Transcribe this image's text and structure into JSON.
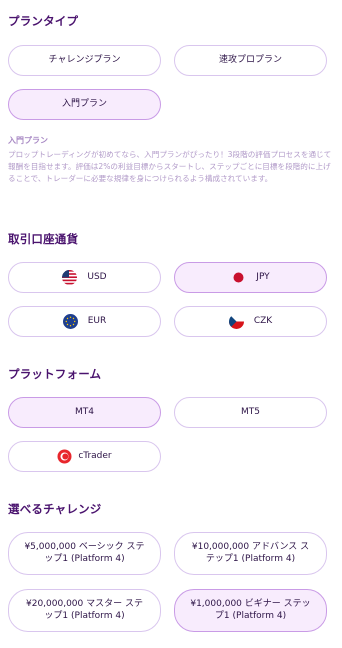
{
  "plan_type": {
    "title": "プランタイプ",
    "options": [
      "チャレンジプラン",
      "速攻プロプラン",
      "入門プラン"
    ],
    "selected": "入門プラン",
    "description_title": "入門プラン",
    "description": "プロップトレーディングが初めてなら、入門プランがぴったり！3段階の評価プロセスを通じて報酬を目指せます。評価は2%の利益目標からスタートし、ステップごとに目標を段階的に上げることで、トレーダーに必要な規律を身につけられるよう構成されています。"
  },
  "currency": {
    "title": "取引口座通貨",
    "options": [
      {
        "label": "USD",
        "icon": "us-flag-icon"
      },
      {
        "label": "JPY",
        "icon": "japan-flag-icon"
      },
      {
        "label": "EUR",
        "icon": "eu-flag-icon"
      },
      {
        "label": "CZK",
        "icon": "czech-flag-icon"
      }
    ],
    "selected": "JPY"
  },
  "platform": {
    "title": "プラットフォーム",
    "options": [
      {
        "label": "MT4"
      },
      {
        "label": "MT5"
      },
      {
        "label": "cTrader",
        "icon": "ctrader-logo-icon"
      }
    ],
    "selected": "MT4"
  },
  "challenge": {
    "title": "選べるチャレンジ",
    "options": [
      "¥5,000,000 ベーシック ステップ1 (Platform 4)",
      "¥10,000,000 アドバンス ステップ1 (Platform 4)",
      "¥20,000,000 マスター ステップ1 (Platform 4)",
      "¥1,000,000 ビギナー ステップ1 (Platform 4)"
    ],
    "selected": "¥1,000,000 ビギナー ステップ1 (Platform 4)"
  },
  "colors": {
    "heading": "#4a136e",
    "pill_border": "#d9c6ee",
    "selected_bg": "#f8ecfd",
    "selected_border": "#c99be6",
    "description": "#b29bc9"
  }
}
